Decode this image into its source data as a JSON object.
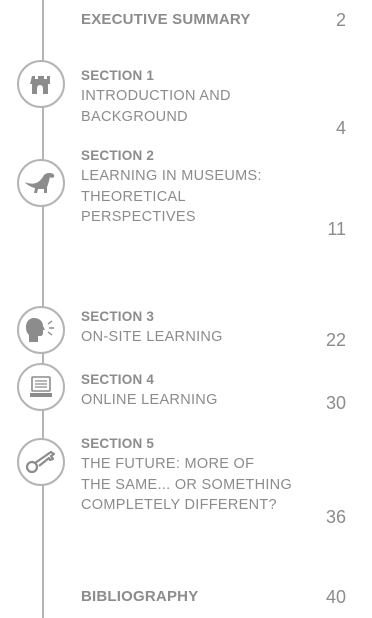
{
  "toc": {
    "executive_summary": {
      "title": "EXECUTIVE SUMMARY",
      "page": "2"
    },
    "sections": [
      {
        "heading": "SECTION 1",
        "lines": [
          "INTRODUCTION AND",
          "BACKGROUND"
        ],
        "page": "4",
        "icon": "castle-icon"
      },
      {
        "heading": "SECTION 2",
        "lines": [
          "LEARNING IN MUSEUMS:",
          "THEORETICAL",
          "PERSPECTIVES"
        ],
        "page": "11",
        "icon": "dinosaur-icon"
      },
      {
        "heading": "SECTION 3",
        "lines": [
          "ON-SITE LEARNING"
        ],
        "page": "22",
        "icon": "speaking-head-icon"
      },
      {
        "heading": "SECTION 4",
        "lines": [
          "ONLINE LEARNING"
        ],
        "page": "30",
        "icon": "computer-icon"
      },
      {
        "heading": "SECTION 5",
        "lines": [
          "THE FUTURE: MORE OF",
          "THE SAME... OR SOMETHING",
          "COMPLETELY DIFFERENT?"
        ],
        "page": "36",
        "icon": "key-icon"
      }
    ],
    "bibliography": {
      "title": "BIBLIOGRAPHY",
      "page": "40"
    }
  },
  "colors": {
    "text": "#8c8c8c",
    "line": "#b4b4b4",
    "icon_fill": "#8c8c8c"
  }
}
